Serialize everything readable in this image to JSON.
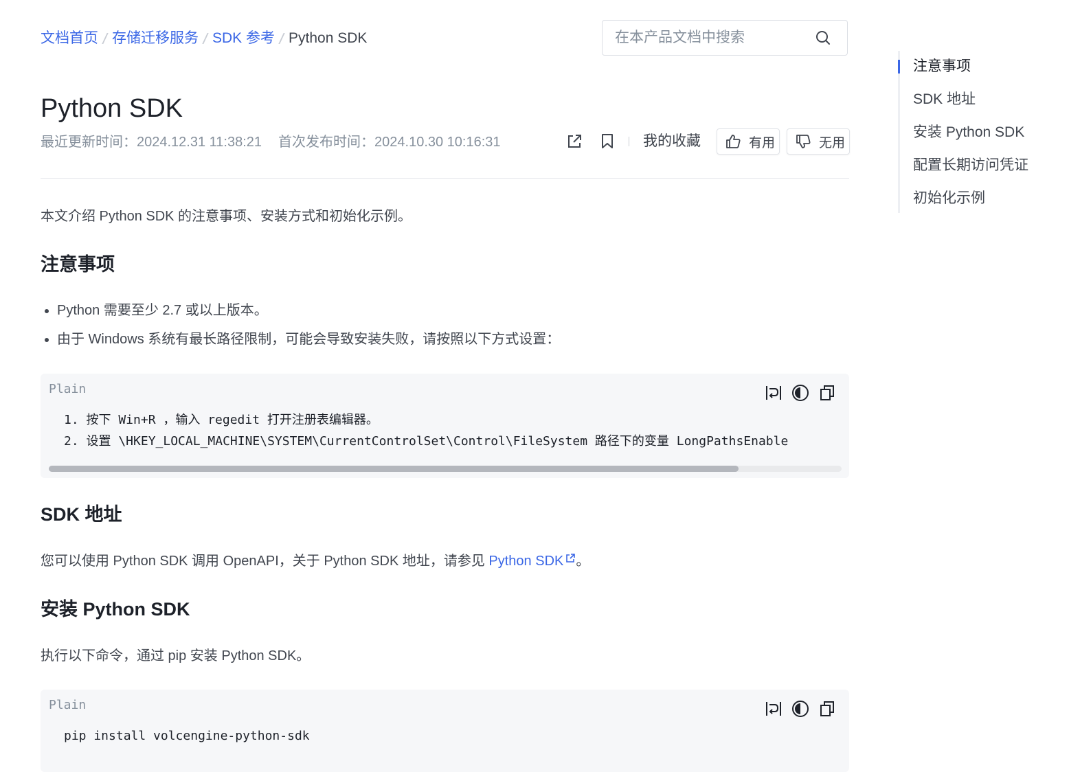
{
  "breadcrumb": {
    "items": [
      "文档首页",
      "存储迁移服务",
      "SDK 参考"
    ],
    "current": "Python SDK"
  },
  "search": {
    "placeholder": "在本产品文档中搜索",
    "value": ""
  },
  "page": {
    "title": "Python SDK",
    "updated": "最近更新时间：2024.12.31 11:38:21",
    "published": "首次发布时间：2024.10.30 10:16:31",
    "favorites_label": "我的收藏",
    "useful_label": "有用",
    "useless_label": "无用"
  },
  "content": {
    "intro": "本文介绍 Python SDK 的注意事项、安装方式和初始化示例。",
    "notes_heading": "注意事项",
    "bullets": [
      "Python 需要至少 2.7 或以上版本。",
      "由于 Windows 系统有最长路径限制，可能会导致安装失败，请按照以下方式设置："
    ],
    "code1": {
      "lang": "Plain",
      "lines": [
        "1. 按下 Win+R ，输入 regedit 打开注册表编辑器。",
        "2. 设置 \\HKEY_LOCAL_MACHINE\\SYSTEM\\CurrentControlSet\\Control\\FileSystem 路径下的变量 LongPathsEnable"
      ],
      "scroll_fraction": 0.87
    },
    "sdk_heading": "SDK 地址",
    "sdk_text": "您可以使用 Python SDK 调用 OpenAPI，关于 Python SDK 地址，请参见 ",
    "sdk_link": "Python SDK",
    "sdk_end": "。",
    "install_heading": "安装 Python SDK",
    "install_text": "执行以下命令，通过 pip 安装 Python SDK。",
    "code2": {
      "lang": "Plain",
      "lines": [
        "pip install volcengine-python-sdk"
      ]
    }
  },
  "toc": {
    "items": [
      "注意事项",
      "SDK 地址",
      "安装 Python SDK",
      "配置长期访问凭证",
      "初始化示例"
    ],
    "active_index": 0
  },
  "colors": {
    "accent": "#3b67e6",
    "text": "#1d2129",
    "muted": "#86909c",
    "code_bg": "#f6f7f9"
  }
}
